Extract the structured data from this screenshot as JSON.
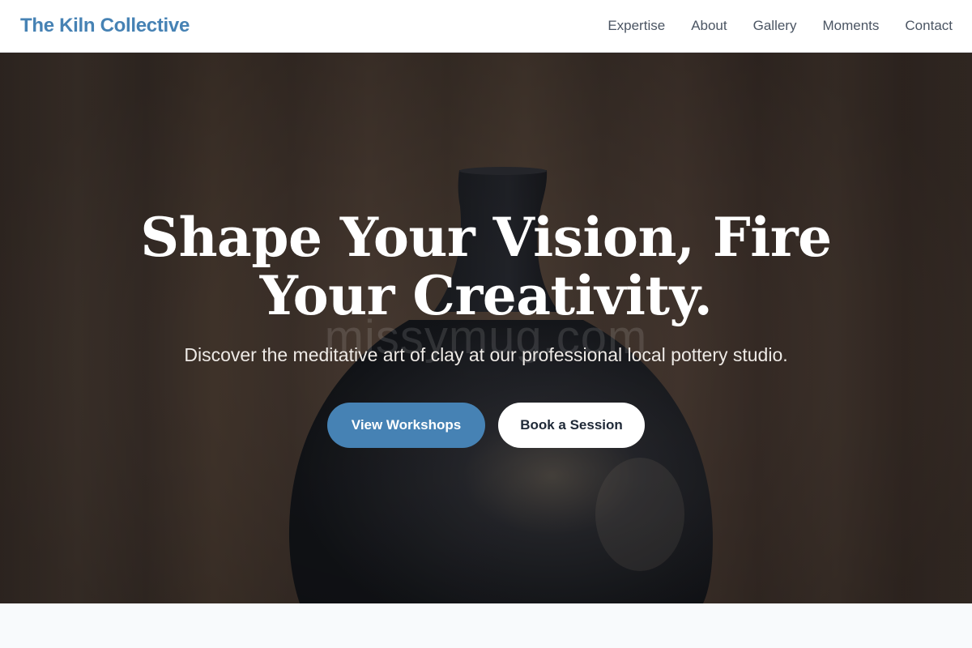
{
  "header": {
    "brand": "The Kiln Collective",
    "nav": [
      {
        "label": "Expertise"
      },
      {
        "label": "About"
      },
      {
        "label": "Gallery"
      },
      {
        "label": "Moments"
      },
      {
        "label": "Contact"
      }
    ]
  },
  "hero": {
    "title_line1": "Shape Your Vision, Fire",
    "title_line2": "Your Creativity.",
    "watermark": "missymug.com",
    "subtitle": "Discover the meditative art of clay at our professional local pottery studio.",
    "primary_button": "View Workshops",
    "secondary_button": "Book a Session",
    "image": "dark-ceramic-vase-photo"
  },
  "colors": {
    "accent": "#4682b4",
    "nav_text": "#4b5563",
    "hero_text": "#ffffff",
    "page_bg": "#f8fafc"
  }
}
